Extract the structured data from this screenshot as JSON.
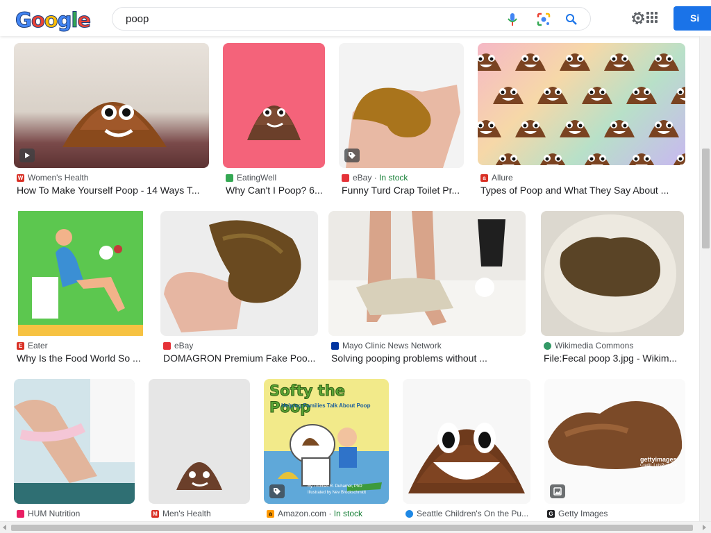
{
  "header": {
    "logo_text": "Google",
    "search_value": "poop",
    "signin_label": "Si"
  },
  "results": [
    {
      "source": "Women's Health",
      "title": "How To Make Yourself Poop - 14 Ways T...",
      "fav_color": "#d93025",
      "fav_glyph": "W",
      "badge": "play-icon"
    },
    {
      "source": "EatingWell",
      "title": "Why Can't I Poop? 6...",
      "fav_color": "#34a853",
      "fav_glyph": "",
      "badge": ""
    },
    {
      "source": "eBay",
      "stock": "In stock",
      "title": "Funny Turd Crap Toilet Pr...",
      "fav_color": "#e53238",
      "fav_glyph": "",
      "badge": "tag-icon"
    },
    {
      "source": "Allure",
      "title": "Types of Poop and What They Say About ...",
      "fav_color": "#d93025",
      "fav_glyph": "a",
      "badge": ""
    },
    {
      "source": "Eater",
      "title": "Why Is the Food World So ...",
      "fav_color": "#d93025",
      "fav_glyph": "E",
      "badge": ""
    },
    {
      "source": "eBay",
      "title": "DOMAGRON Premium Fake Poo...",
      "fav_color": "#e53238",
      "fav_glyph": "",
      "badge": ""
    },
    {
      "source": "Mayo Clinic News Network",
      "title": "Solving pooping problems without ...",
      "fav_color": "#0033a0",
      "fav_glyph": "",
      "badge": ""
    },
    {
      "source": "Wikimedia Commons",
      "title": "File:Fecal poop 3.jpg - Wikim...",
      "fav_color": "#339966",
      "fav_glyph": "",
      "badge": ""
    },
    {
      "source": "HUM Nutrition",
      "title": "",
      "fav_color": "#e91e63",
      "fav_glyph": "",
      "badge": ""
    },
    {
      "source": "Men's Health",
      "title": "",
      "fav_color": "#d93025",
      "fav_glyph": "M",
      "badge": ""
    },
    {
      "source": "Amazon.com",
      "stock": "In stock",
      "title": "",
      "fav_color": "#ff9900",
      "fav_glyph": "a",
      "badge": "tag-icon"
    },
    {
      "source": "Seattle Children's On the Pu...",
      "title": "",
      "fav_color": "#1e88e5",
      "fav_glyph": "",
      "badge": ""
    },
    {
      "source": "Getty Images",
      "title": "",
      "fav_color": "#202124",
      "fav_glyph": "G",
      "badge": "image-icon"
    }
  ],
  "image_text": {
    "softy_title": "Softy the Poop",
    "softy_subtitle": "Helping Families Talk About Poop",
    "softy_author": "By Thomas R. Duhamel, PhD",
    "softy_illustrator": "Illustrated by Nev Brockschmidt",
    "getty_watermark": "gettyimages",
    "getty_credit": "Credit: LuisPortugal"
  }
}
